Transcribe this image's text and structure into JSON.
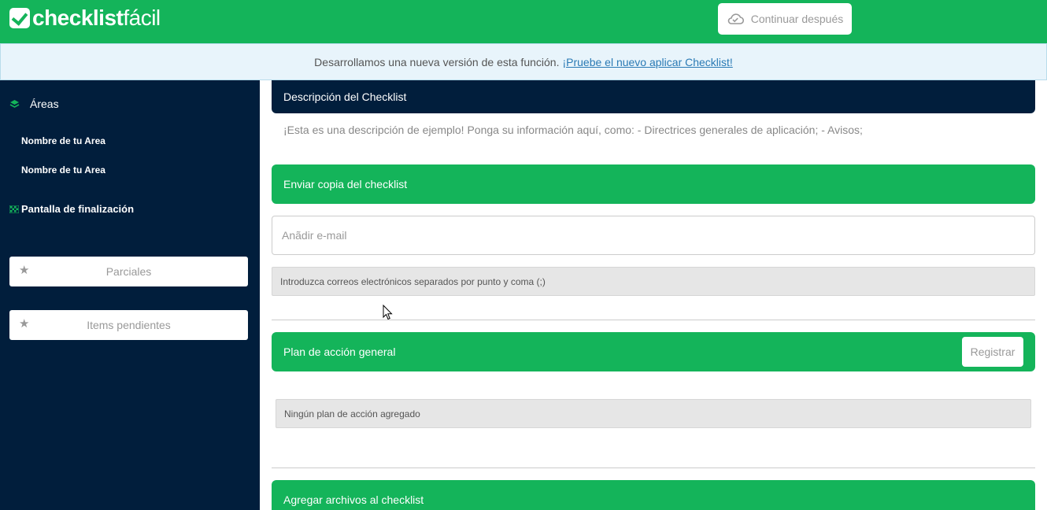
{
  "header": {
    "logo_bold": "checklist",
    "logo_light": "fácil",
    "continue_label": "Continuar después"
  },
  "banner": {
    "text": "Desarrollamos una nueva versión de esta función.",
    "link": "¡Pruebe el nuevo aplicar Checklist!"
  },
  "sidebar": {
    "areas_label": "Áreas",
    "area_items": [
      "Nombre de tu Area",
      "Nombre de tu Area"
    ],
    "final_label": "Pantalla de finalización",
    "partials_label": "Parciales",
    "pending_label": "Items pendientes"
  },
  "main": {
    "description_title": "Descripción del Checklist",
    "description_text": "¡Esta es una descripción de ejemplo! Ponga su información aquí, como: - Directrices generales de aplicación; - Avisos;",
    "send_copy_title": "Enviar copia del checklist",
    "email_placeholder": "Anãdir e-mail",
    "email_hint": "Introduzca correos electrónicos separados por punto y coma (;)",
    "action_plan_title": "Plan de acción general",
    "register_label": "Registrar",
    "no_action_plan": "Ningún plan de acción agregado",
    "attach_files_title": "Agregar archivos al checklist"
  },
  "colors": {
    "brand_green": "#14b45a",
    "navy": "#011e3c",
    "banner_bg": "#e8f4fb",
    "link_blue": "#2a7ab5"
  },
  "icons": [
    "checklist-logo-icon",
    "cloud-check-icon",
    "layers-icon",
    "checkered-flag-icon",
    "star-icon",
    "mouse-cursor-icon"
  ]
}
